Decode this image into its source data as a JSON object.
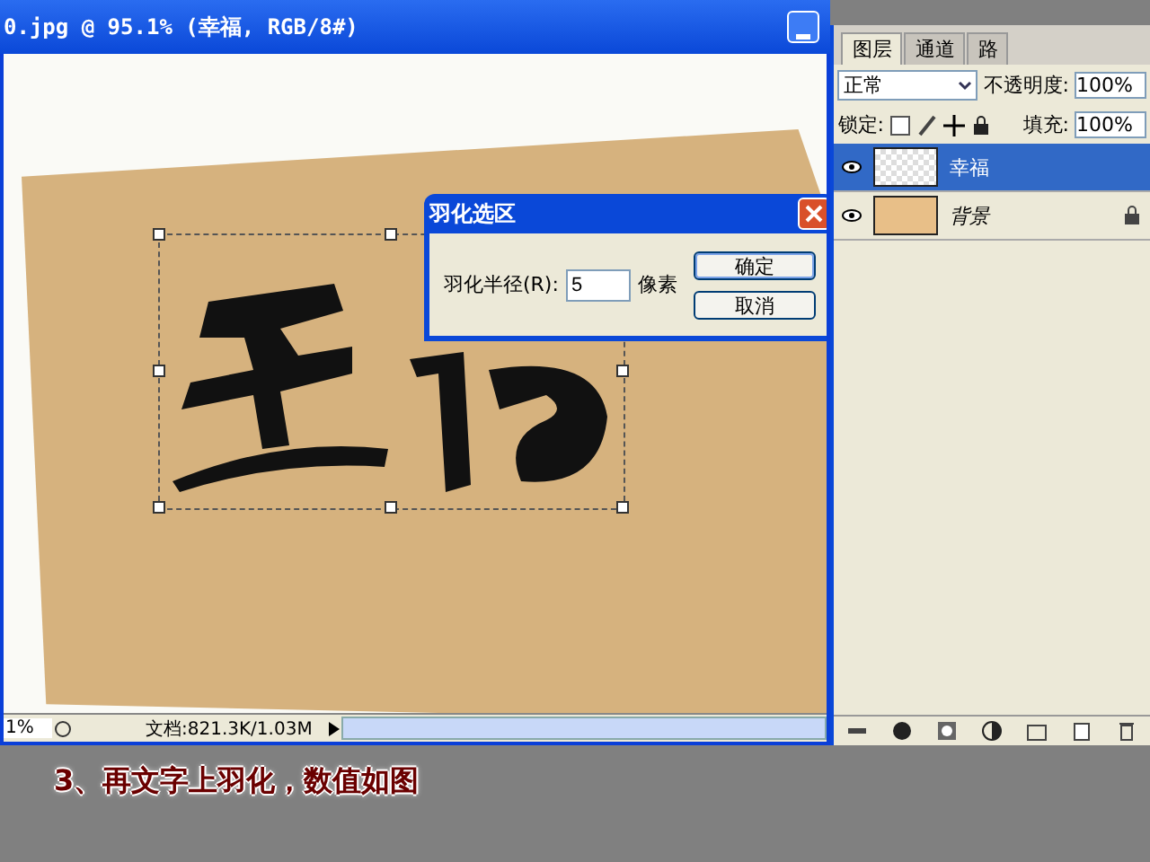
{
  "document": {
    "title": "0.jpg @ 95.1% (幸福, RGB/8#)",
    "zoom": "1%",
    "doc_info": "文档:821.3K/1.03M"
  },
  "dialog": {
    "title": "羽化选区",
    "label": "羽化半径(R):",
    "value": "5",
    "unit": "像素",
    "buttons": [
      {
        "label": "确定",
        "default": true
      },
      {
        "label": "取消",
        "default": false
      }
    ]
  },
  "layers_panel": {
    "tabs": [
      {
        "label": "图层",
        "selected": true
      },
      {
        "label": "通道",
        "selected": false
      },
      {
        "label": "路",
        "selected": false
      }
    ],
    "blend_mode": "正常",
    "opacity_label": "不透明度:",
    "opacity": "100%",
    "lock_label": "锁定:",
    "fill_label": "填充:",
    "fill": "100%",
    "layers": [
      {
        "name": "幸福",
        "kind": "text",
        "selected": true,
        "locked": false
      },
      {
        "name": "背景",
        "kind": "fill",
        "selected": false,
        "locked": true
      }
    ]
  },
  "caption": "3、再文字上羽化，数值如图"
}
